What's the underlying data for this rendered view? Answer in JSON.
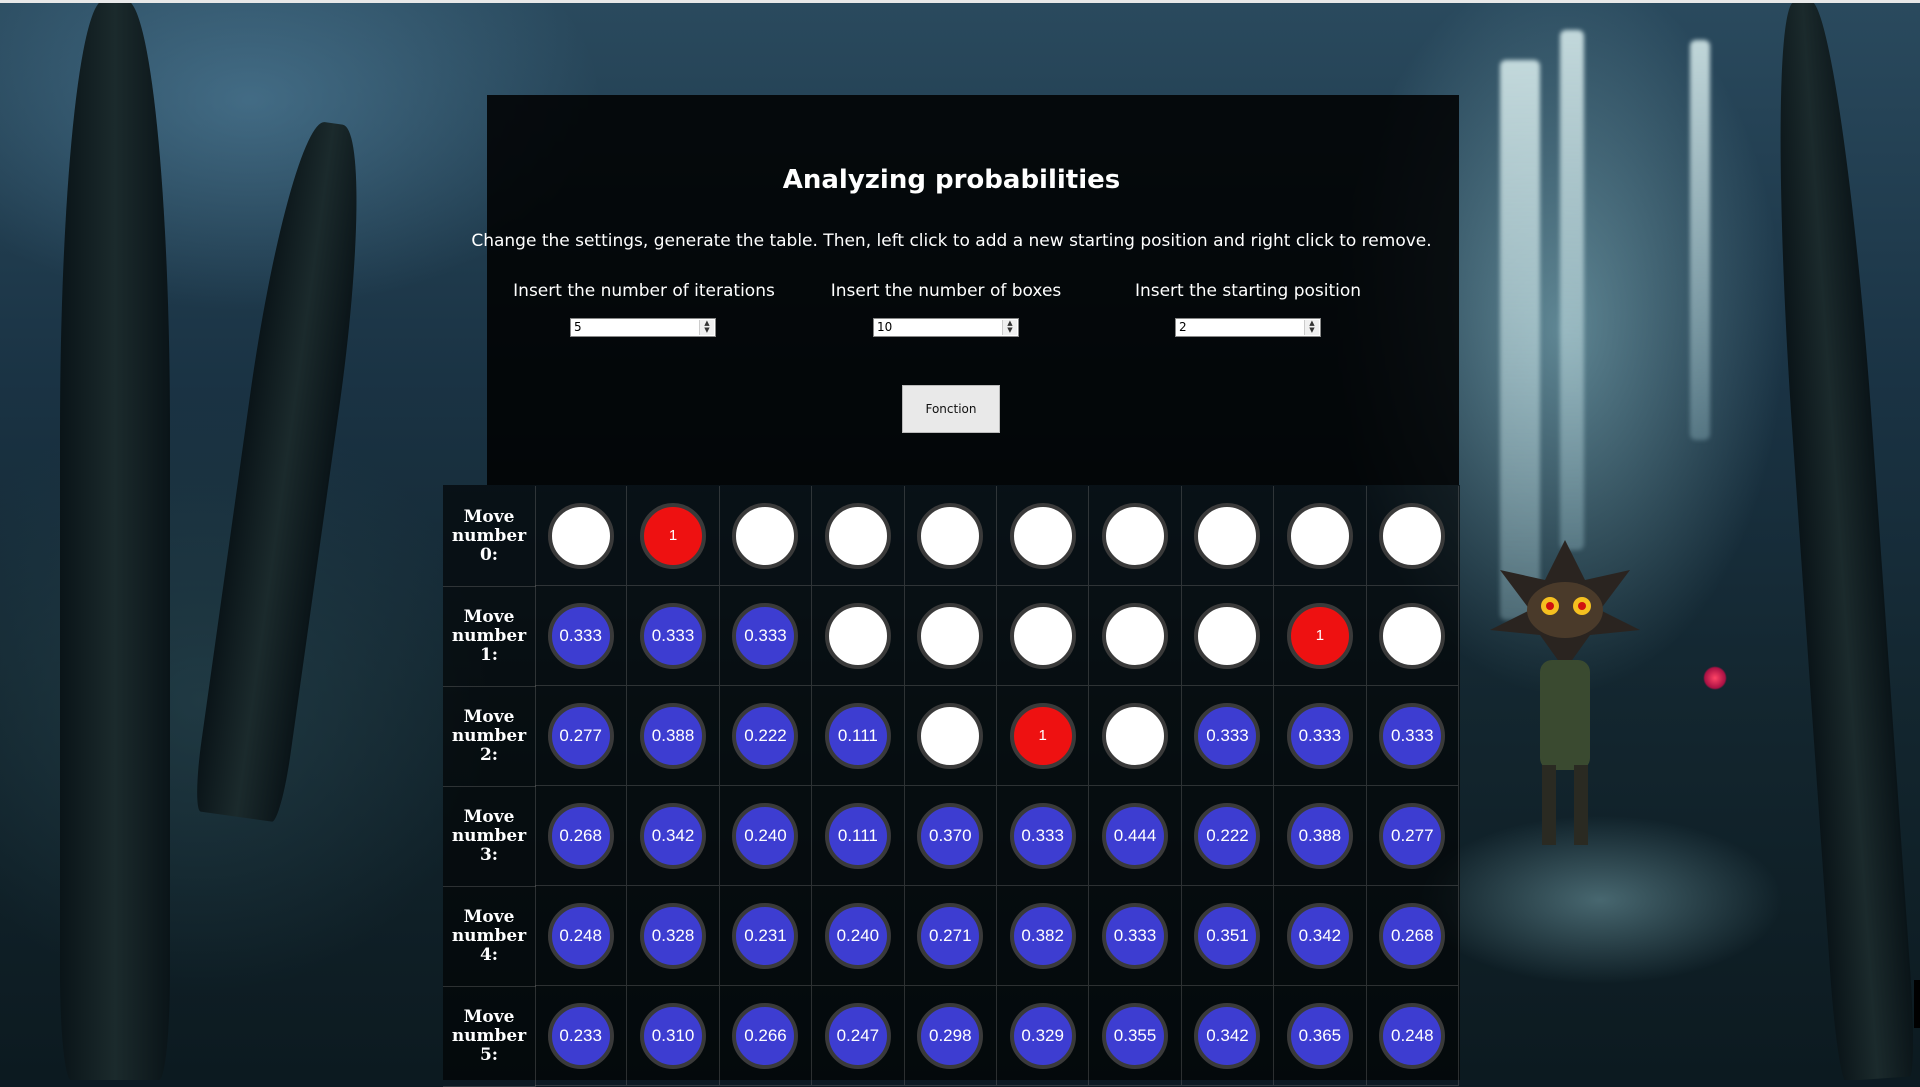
{
  "page": {
    "title": "Analyzing probabilities",
    "description": "Change the settings, generate the table. Then, left click to add a new starting position and right click to remove."
  },
  "settings": {
    "iterations": {
      "label": "Insert the number of iterations",
      "value": "5"
    },
    "boxes": {
      "label": "Insert the number of boxes",
      "value": "10"
    },
    "start": {
      "label": "Insert the starting position",
      "value": "2"
    }
  },
  "button": {
    "label": "Fonction"
  },
  "colors": {
    "empty": "#ffffff",
    "start": "#ee1111",
    "probability": "#3d3dd1"
  },
  "grid": {
    "rows": [
      {
        "label": "Move number 0:",
        "cells": [
          {
            "t": "w",
            "v": ""
          },
          {
            "t": "r",
            "v": "1"
          },
          {
            "t": "w",
            "v": ""
          },
          {
            "t": "w",
            "v": ""
          },
          {
            "t": "w",
            "v": ""
          },
          {
            "t": "w",
            "v": ""
          },
          {
            "t": "w",
            "v": ""
          },
          {
            "t": "w",
            "v": ""
          },
          {
            "t": "w",
            "v": ""
          },
          {
            "t": "w",
            "v": ""
          }
        ]
      },
      {
        "label": "Move number 1:",
        "cells": [
          {
            "t": "b",
            "v": "0.333"
          },
          {
            "t": "b",
            "v": "0.333"
          },
          {
            "t": "b",
            "v": "0.333"
          },
          {
            "t": "w",
            "v": ""
          },
          {
            "t": "w",
            "v": ""
          },
          {
            "t": "w",
            "v": ""
          },
          {
            "t": "w",
            "v": ""
          },
          {
            "t": "w",
            "v": ""
          },
          {
            "t": "r",
            "v": "1"
          },
          {
            "t": "w",
            "v": ""
          }
        ]
      },
      {
        "label": "Move number 2:",
        "cells": [
          {
            "t": "b",
            "v": "0.277"
          },
          {
            "t": "b",
            "v": "0.388"
          },
          {
            "t": "b",
            "v": "0.222"
          },
          {
            "t": "b",
            "v": "0.111"
          },
          {
            "t": "w",
            "v": ""
          },
          {
            "t": "r",
            "v": "1"
          },
          {
            "t": "w",
            "v": ""
          },
          {
            "t": "b",
            "v": "0.333"
          },
          {
            "t": "b",
            "v": "0.333"
          },
          {
            "t": "b",
            "v": "0.333"
          }
        ]
      },
      {
        "label": "Move number 3:",
        "cells": [
          {
            "t": "b",
            "v": "0.268"
          },
          {
            "t": "b",
            "v": "0.342"
          },
          {
            "t": "b",
            "v": "0.240"
          },
          {
            "t": "b",
            "v": "0.111"
          },
          {
            "t": "b",
            "v": "0.370"
          },
          {
            "t": "b",
            "v": "0.333"
          },
          {
            "t": "b",
            "v": "0.444"
          },
          {
            "t": "b",
            "v": "0.222"
          },
          {
            "t": "b",
            "v": "0.388"
          },
          {
            "t": "b",
            "v": "0.277"
          }
        ]
      },
      {
        "label": "Move number 4:",
        "cells": [
          {
            "t": "b",
            "v": "0.248"
          },
          {
            "t": "b",
            "v": "0.328"
          },
          {
            "t": "b",
            "v": "0.231"
          },
          {
            "t": "b",
            "v": "0.240"
          },
          {
            "t": "b",
            "v": "0.271"
          },
          {
            "t": "b",
            "v": "0.382"
          },
          {
            "t": "b",
            "v": "0.333"
          },
          {
            "t": "b",
            "v": "0.351"
          },
          {
            "t": "b",
            "v": "0.342"
          },
          {
            "t": "b",
            "v": "0.268"
          }
        ]
      },
      {
        "label": "Move number 5:",
        "cells": [
          {
            "t": "b",
            "v": "0.233"
          },
          {
            "t": "b",
            "v": "0.310"
          },
          {
            "t": "b",
            "v": "0.266"
          },
          {
            "t": "b",
            "v": "0.247"
          },
          {
            "t": "b",
            "v": "0.298"
          },
          {
            "t": "b",
            "v": "0.329"
          },
          {
            "t": "b",
            "v": "0.355"
          },
          {
            "t": "b",
            "v": "0.342"
          },
          {
            "t": "b",
            "v": "0.365"
          },
          {
            "t": "b",
            "v": "0.248"
          }
        ]
      }
    ]
  }
}
